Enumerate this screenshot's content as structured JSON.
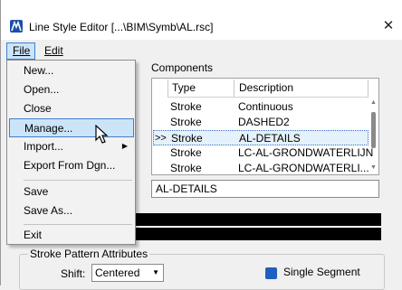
{
  "window": {
    "title": "Line Style Editor [...\\BIM\\Symb\\AL.rsc]",
    "close_glyph": "✕",
    "icon": "microstation-logo-icon"
  },
  "menubar": {
    "file": "File",
    "edit": "Edit"
  },
  "file_menu": {
    "new": "New...",
    "open": "Open...",
    "close": "Close",
    "manage": "Manage...",
    "import": "Import...",
    "export_from_dgn": "Export From Dgn...",
    "save": "Save",
    "save_as": "Save As...",
    "exit": "Exit",
    "highlighted": "Manage...",
    "submenu_arrow": "▶"
  },
  "components": {
    "label": "Components",
    "columns": {
      "type": "Type",
      "description": "Description"
    },
    "rows": [
      {
        "marker": "",
        "type": "Stroke",
        "description": "Continuous"
      },
      {
        "marker": "",
        "type": "Stroke",
        "description": "DASHED2"
      },
      {
        "marker": ">>",
        "type": "Stroke",
        "description": "AL-DETAILS"
      },
      {
        "marker": "",
        "type": "Stroke",
        "description": "LC-AL-GRONDWATERLIJN"
      },
      {
        "marker": "",
        "type": "Stroke",
        "description": "LC-AL-GRONDWATERLI..."
      }
    ],
    "selected_row": 2,
    "scroll_up": "▲",
    "scroll_down": "▼"
  },
  "detail_name": "AL-DETAILS",
  "stroke_pattern": {
    "group_label": "Stroke Pattern Attributes",
    "shift_label": "Shift:",
    "shift_value": "Centered",
    "shift_chevron": "▼",
    "single_segment_label": "Single Segment",
    "single_segment_checked": true
  },
  "colors": {
    "accent": "#3f7fcf",
    "highlight_bg": "#cce4f7",
    "selection_bg": "#e5f1fb",
    "preview_bg": "#000000",
    "checkbox": "#1f5fbf"
  }
}
